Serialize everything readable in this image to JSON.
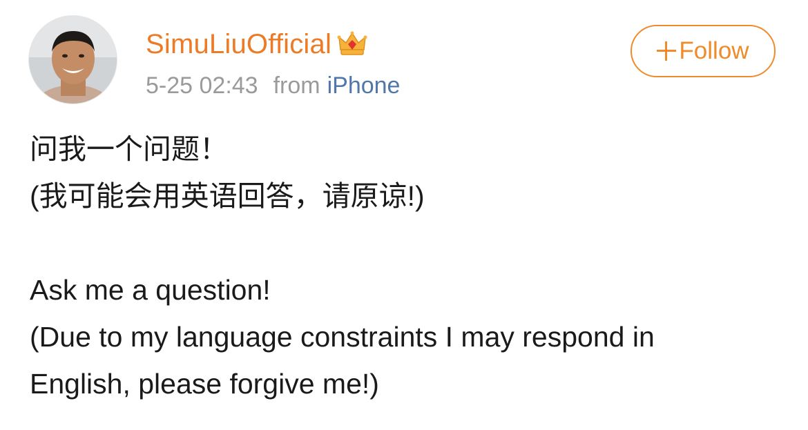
{
  "post": {
    "author": {
      "name": "SimuLiuOfficial",
      "badge_icon": "crown-vip-icon"
    },
    "timestamp": "5-25 02:43",
    "from_label": "from",
    "device": "iPhone",
    "follow_label": "Follow",
    "body": {
      "chinese_line1": "问我一个问题！",
      "chinese_line2": "(我可能会用英语回答，请原谅!)",
      "english_line1": "Ask me a question!",
      "english_line2": "(Due to my language constraints I may respond in",
      "english_line3": "English, please forgive me!)"
    }
  },
  "colors": {
    "username": "#eb7b27",
    "follow": "#f08a2a",
    "meta": "#9a9a9a",
    "link": "#5077aa",
    "text": "#1a1a1a"
  }
}
